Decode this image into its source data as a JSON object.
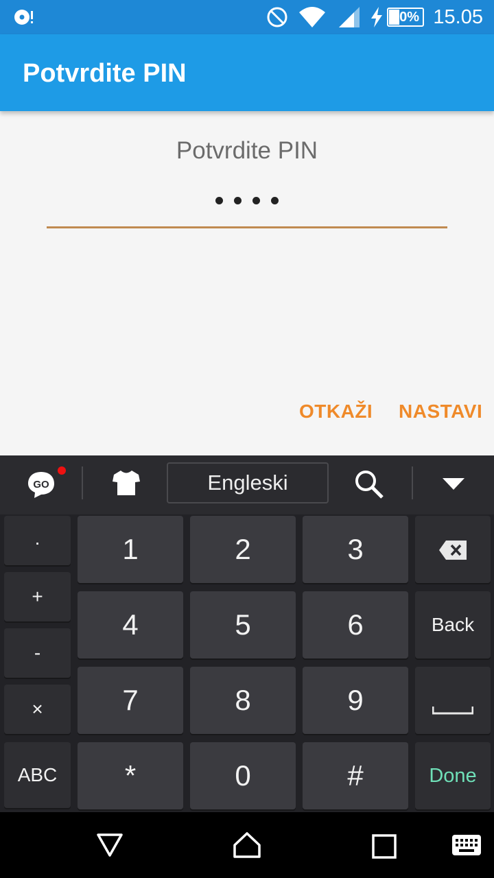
{
  "status_bar": {
    "time": "15.05",
    "battery": "30%",
    "icons": [
      "media-icon",
      "do-not-disturb-icon",
      "wifi-icon",
      "signal-icon",
      "charging-icon",
      "battery-icon"
    ]
  },
  "app_bar": {
    "title": "Potvrdite PIN"
  },
  "dialog": {
    "label": "Potvrdite PIN",
    "pin_length": 4,
    "cancel": "OTKAŽI",
    "next": "NASTAVI",
    "accent_color": "#ef8a2a",
    "underline_color": "#c08a50"
  },
  "keyboard": {
    "language": "Engleski",
    "side_keys": [
      ".",
      "+",
      "-",
      "×",
      "ABC"
    ],
    "digits": [
      "1",
      "2",
      "3",
      "4",
      "5",
      "6",
      "7",
      "8",
      "9",
      "*",
      "0",
      "#"
    ],
    "back": "Back",
    "done": "Done",
    "done_color": "#6fe0b8"
  },
  "colors": {
    "app_bar": "#1e9be6",
    "status_bar": "#1e88d6"
  }
}
